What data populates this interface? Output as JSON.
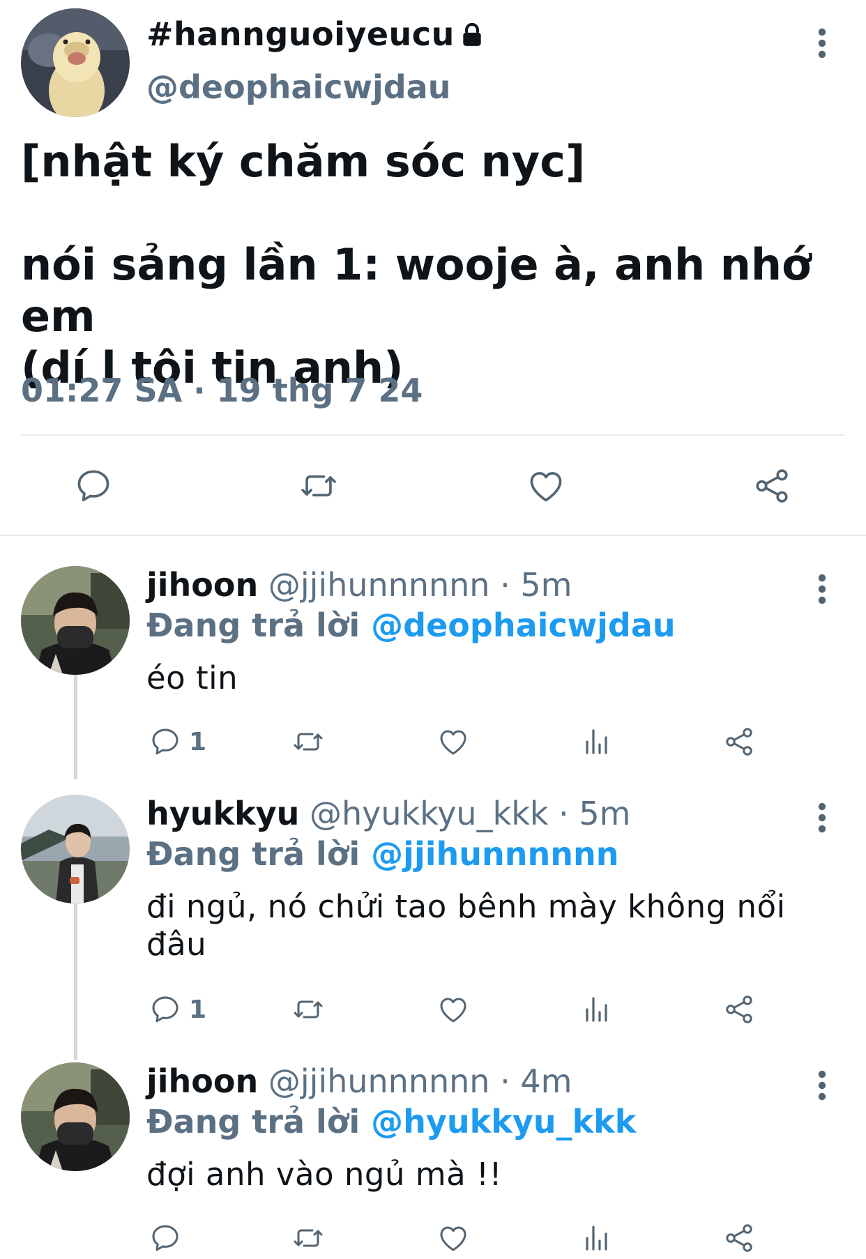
{
  "main_tweet": {
    "display_name": "#hannguoiyeucu",
    "handle": "@deophaicwjdau",
    "text": "[nhật ký chăm sóc nyc]\n\nnói sảng lần 1: wooje à, anh nhớ em\n(dí l tôi tin anh)",
    "timestamp": "01:27 SA · 19 thg 7 24",
    "avatar_icon": "duckling-avatar"
  },
  "icons": {
    "reply": "reply-icon",
    "retweet": "retweet-icon",
    "like": "heart-icon",
    "views": "views-bar-icon",
    "share": "share-icon",
    "more": "more-vertical-icon",
    "lock": "lock-icon"
  },
  "colors": {
    "text": "#0f1419",
    "secondary": "#5b7083",
    "mention": "#1d9bf0",
    "divider": "#e6ecf0",
    "icon": "#536471"
  },
  "replies": [
    {
      "name": "jihoon",
      "handle": "@jjihunnnnnn",
      "sep": "·",
      "time": "5m",
      "replying_prefix": "Đang trả lời",
      "replying_to": "@deophaicwjdau",
      "text": "éo tin",
      "reply_count": "1"
    },
    {
      "name": "hyukkyu",
      "handle": "@hyukkyu_kkk",
      "sep": "·",
      "time": "5m",
      "replying_prefix": "Đang trả lời",
      "replying_to": "@jjihunnnnnn",
      "text": "đi ngủ, nó chửi tao bênh mày không nổi đâu",
      "reply_count": "1"
    },
    {
      "name": "jihoon",
      "handle": "@jjihunnnnnn",
      "sep": "·",
      "time": "4m",
      "replying_prefix": "Đang trả lời",
      "replying_to": "@hyukkyu_kkk",
      "text": "đợi anh vào ngủ mà !!",
      "reply_count": ""
    }
  ]
}
